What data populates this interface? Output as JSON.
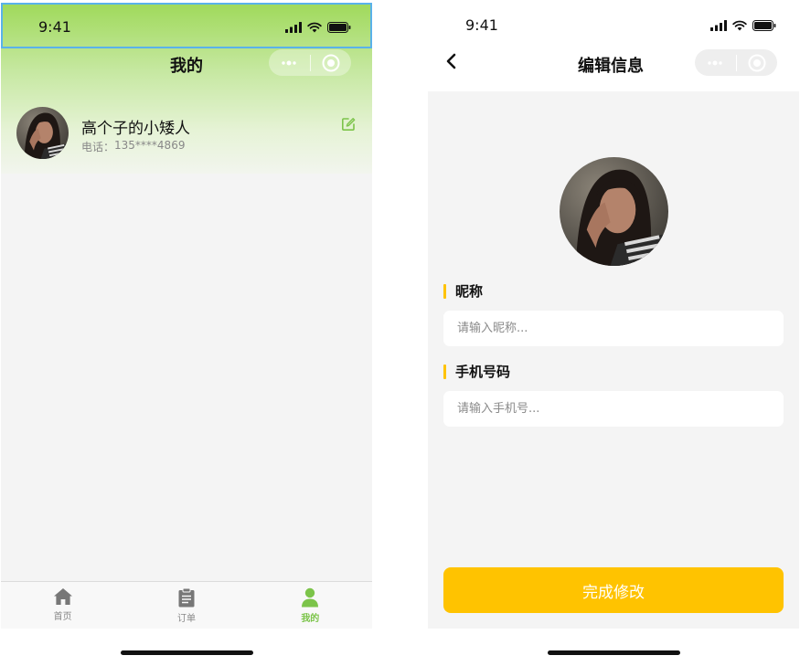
{
  "left": {
    "status_time": "9:41",
    "nav_title": "我的",
    "user": {
      "name": "高个子的小矮人",
      "phone_label": "电话：",
      "phone": "135****4869"
    },
    "tabs": [
      {
        "label": "首页",
        "icon": "home-icon",
        "active": false
      },
      {
        "label": "订单",
        "icon": "clipboard-icon",
        "active": false
      },
      {
        "label": "我的",
        "icon": "person-icon",
        "active": true
      }
    ]
  },
  "right": {
    "status_time": "9:41",
    "nav_title": "编辑信息",
    "nickname": {
      "label": "昵称",
      "placeholder": "请输入昵称..."
    },
    "phone": {
      "label": "手机号码",
      "placeholder": "请输入手机号..."
    },
    "submit_label": "完成修改"
  },
  "colors": {
    "accent_green": "#7cc44a",
    "accent_yellow": "#ffc300",
    "selection_blue": "#5ab2ea"
  }
}
